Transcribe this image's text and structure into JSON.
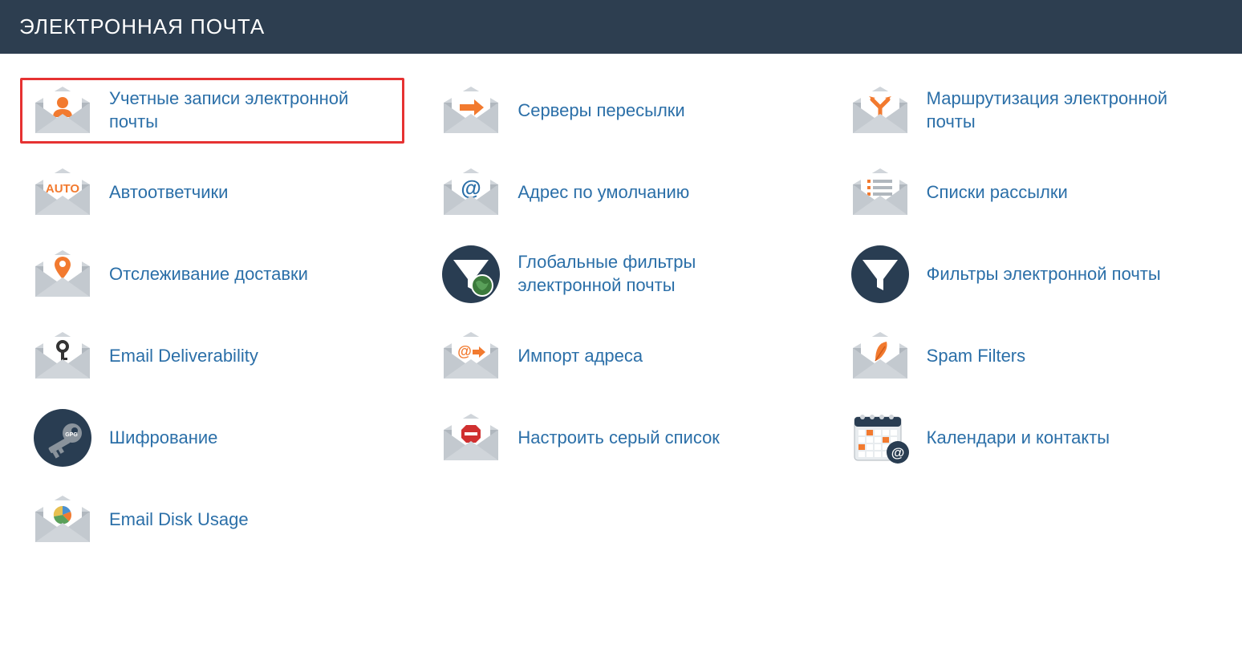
{
  "section_title": "ЭЛЕКТРОННАЯ ПОЧТА",
  "items": [
    {
      "id": "email-accounts",
      "icon": "envelope-person",
      "label": "Учетные записи электронной почты",
      "highlighted": true
    },
    {
      "id": "forwarders",
      "icon": "envelope-arrow",
      "label": "Серверы пересылки"
    },
    {
      "id": "email-routing",
      "icon": "envelope-split",
      "label": "Маршрутизация электронной почты"
    },
    {
      "id": "autoresponders",
      "icon": "envelope-auto",
      "label": "Автоответчики"
    },
    {
      "id": "default-address",
      "icon": "envelope-at",
      "label": "Адрес по умолчанию"
    },
    {
      "id": "mailing-lists",
      "icon": "envelope-list",
      "label": "Списки рассылки"
    },
    {
      "id": "track-delivery",
      "icon": "envelope-pin",
      "label": "Отслеживание доставки"
    },
    {
      "id": "global-filters",
      "icon": "funnel-globe",
      "label": "Глобальные фильтры электронной почты"
    },
    {
      "id": "email-filters",
      "icon": "funnel",
      "label": "Фильтры электронной почты"
    },
    {
      "id": "email-deliverability",
      "icon": "envelope-key",
      "label": "Email Deliverability"
    },
    {
      "id": "address-importer",
      "icon": "envelope-at-arrow",
      "label": "Импорт адреса"
    },
    {
      "id": "spam-filters",
      "icon": "envelope-feather",
      "label": "Spam Filters"
    },
    {
      "id": "encryption",
      "icon": "key-circle",
      "label": "Шифрование"
    },
    {
      "id": "greylisting",
      "icon": "envelope-stop",
      "label": "Настроить серый список"
    },
    {
      "id": "calendars-contacts",
      "icon": "calendar-at",
      "label": "Календари и контакты"
    },
    {
      "id": "email-disk-usage",
      "icon": "envelope-pie",
      "label": "Email Disk Usage"
    }
  ],
  "colors": {
    "accent_orange": "#f27a2f",
    "link_blue": "#2b6fa8",
    "header_bg": "#2d3e50",
    "highlight": "#e63232",
    "env_light": "#d0d5da",
    "env_dark": "#b0b7be",
    "env_face": "#ffffff",
    "circle_navy": "#293d52"
  }
}
